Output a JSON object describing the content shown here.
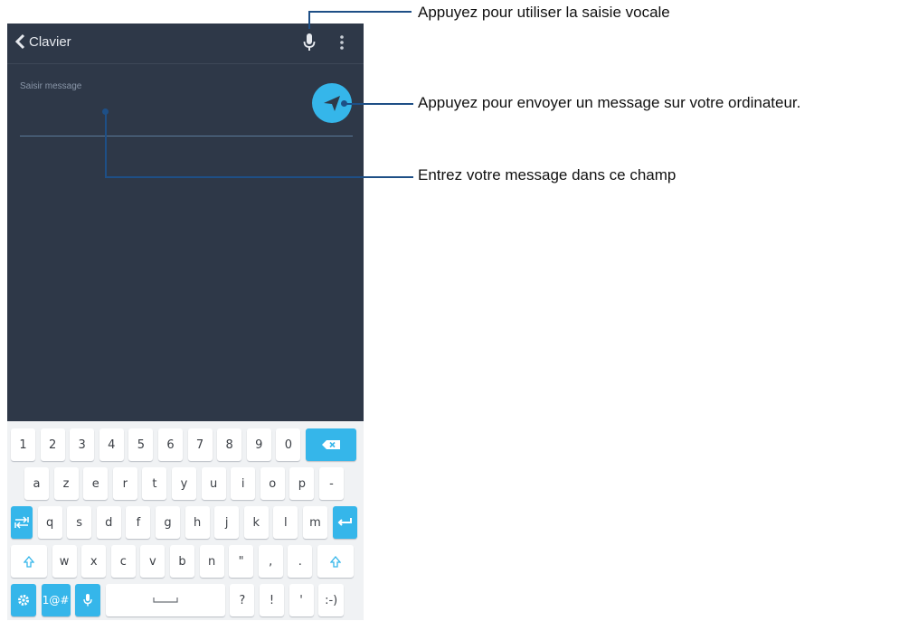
{
  "header": {
    "back_label": "Clavier"
  },
  "input": {
    "placeholder": "Saisir message"
  },
  "keyboard": {
    "numbers": [
      "1",
      "2",
      "3",
      "4",
      "5",
      "6",
      "7",
      "8",
      "9",
      "0"
    ],
    "row1": [
      "a",
      "z",
      "e",
      "r",
      "t",
      "y",
      "u",
      "i",
      "o",
      "p",
      "-"
    ],
    "row2": [
      "q",
      "s",
      "d",
      "f",
      "g",
      "h",
      "j",
      "k",
      "l",
      "m"
    ],
    "row3": [
      "w",
      "x",
      "c",
      "v",
      "b",
      "n",
      "\"",
      ",",
      "."
    ],
    "sym_label": "1@#",
    "bottom": [
      "?",
      "!",
      "'",
      ":-)"
    ]
  },
  "annotations": {
    "voice": "Appuyez pour utiliser la saisie vocale",
    "send": "Appuyez pour envoyer un message sur votre ordinateur.",
    "input": "Entrez votre message dans ce champ"
  },
  "colors": {
    "screen_bg": "#2e3848",
    "accent": "#35b6ea",
    "callout_line": "#1e4f86"
  },
  "icons": [
    "chevron-left-icon",
    "microphone-icon",
    "more-vertical-icon",
    "send-icon",
    "backspace-icon",
    "tab-icon",
    "enter-icon",
    "shift-icon",
    "settings-icon",
    "space-icon"
  ]
}
